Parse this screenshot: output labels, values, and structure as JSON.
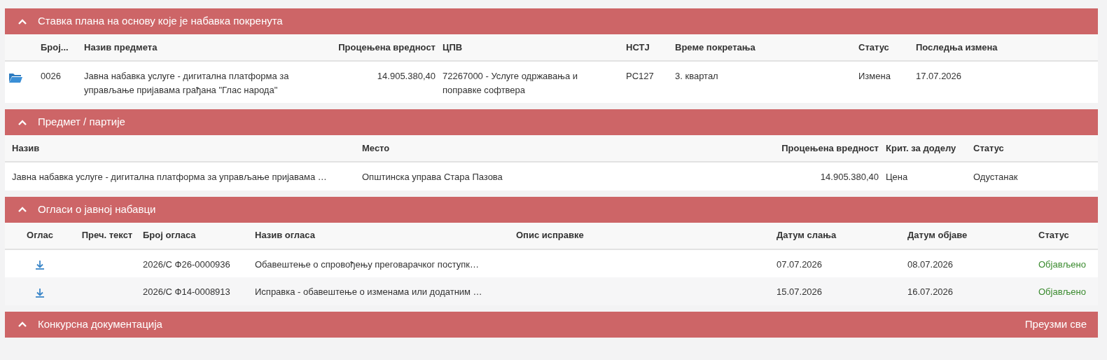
{
  "sections": [
    {
      "title": "Ставка плана на основу које је набавка покренута",
      "expanded": true,
      "columns": [
        null,
        "Број...",
        "Назив предмета",
        "Процењена вредност",
        "ЦПВ",
        "НСТЈ",
        "Време покретања",
        "Статус",
        "Последња измена"
      ],
      "rows": [
        {
          "cells": [
            {
              "kind": "folder"
            },
            "0026",
            "Јавна набавка услуге - дигитална платформа  за управљање пријавама грађана \"Глас народа\"",
            "14.905.380,40",
            "72267000 - Услуге одржавања и поправке софтвера",
            "PC127",
            "3. квартал",
            "Измена",
            "17.07.2026"
          ]
        }
      ]
    },
    {
      "title": "Предмет / партије",
      "expanded": true,
      "columns": [
        "Назив",
        "Место",
        "Процењена вредност",
        "Крит. за доделу",
        "Статус"
      ],
      "rows": [
        {
          "cells": [
            "Јавна набавка услуге - дигитална платформа  за управљање пријавама …",
            "Општинска управа Стара Пазова",
            "14.905.380,40",
            "Цена",
            "Одустанак"
          ]
        }
      ]
    },
    {
      "title": "Огласи о јавној набавци",
      "expanded": true,
      "columns": [
        "Оглас",
        "Преч. текст",
        "Број огласа",
        "Назив огласа",
        "Опис исправке",
        "Датум слања",
        "Датум објаве",
        "Статус"
      ],
      "rows": [
        {
          "cells": [
            {
              "kind": "download"
            },
            null,
            "2026/С Ф26-0000936",
            "Обавештење о спровођењу преговарачког поступк…",
            null,
            "07.07.2026",
            "08.07.2026",
            "Објављено"
          ]
        },
        {
          "cells": [
            {
              "kind": "download"
            },
            null,
            "2026/С Ф14-0008913",
            "Исправка - обавештење о изменама или додатним …",
            null,
            "15.07.2026",
            "16.07.2026",
            "Објављено"
          ]
        }
      ]
    },
    {
      "title": "Конкурсна документација",
      "expanded": true,
      "action": "Преузми све"
    }
  ]
}
